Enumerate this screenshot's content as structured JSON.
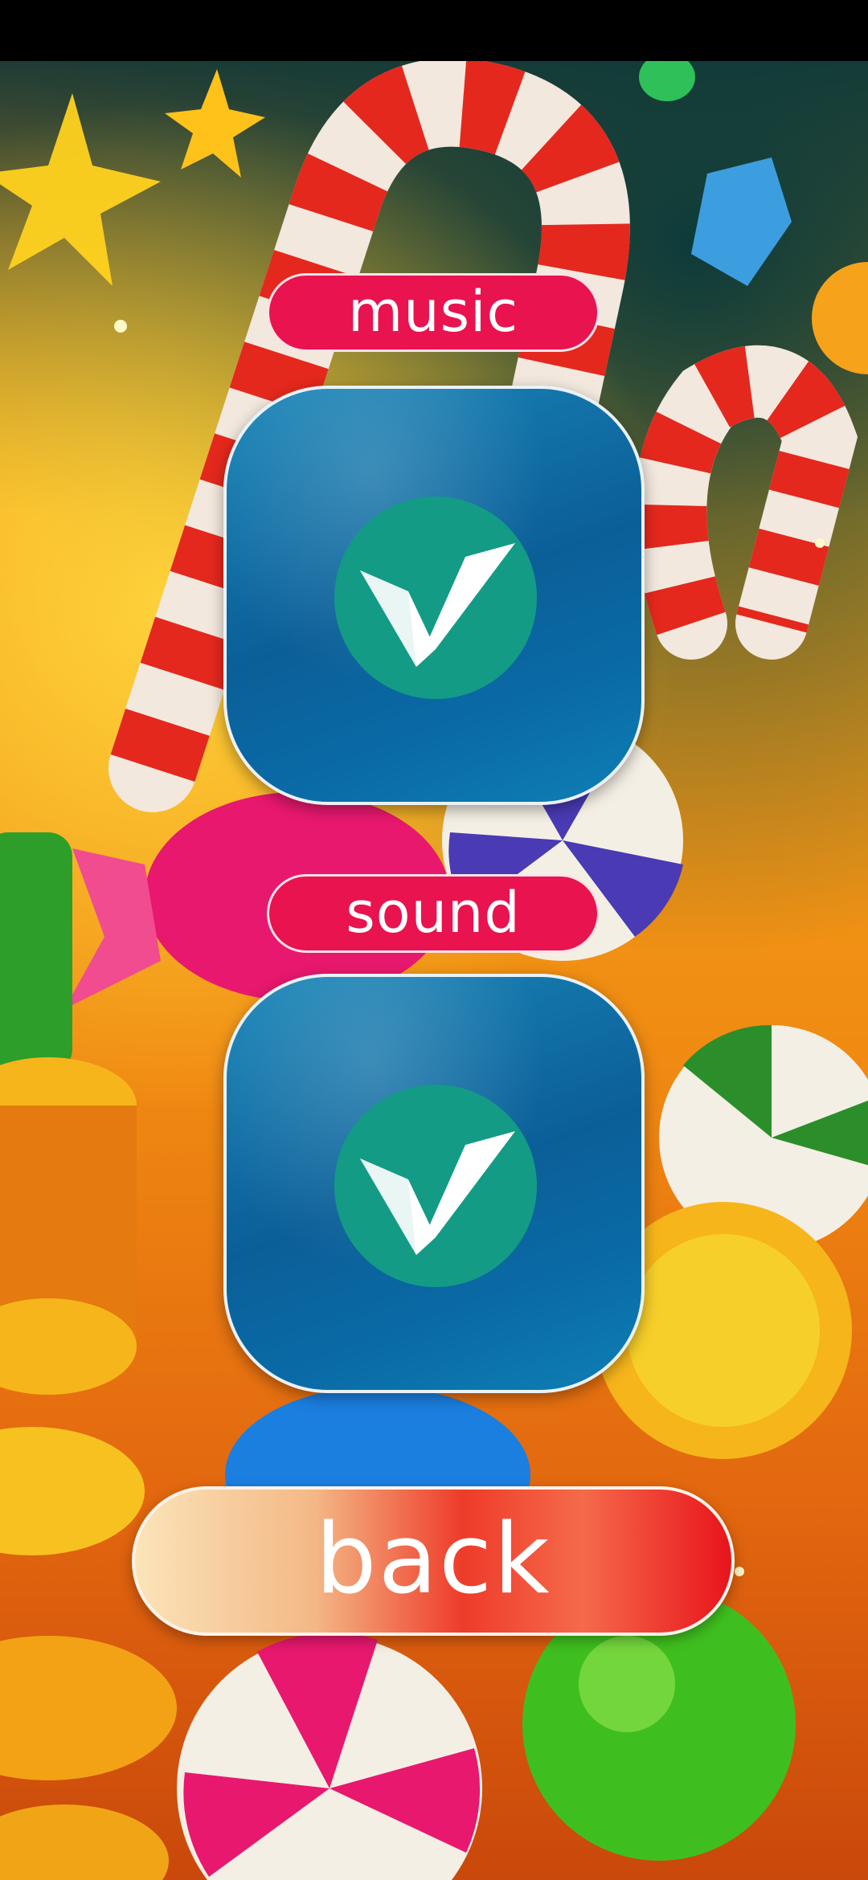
{
  "settings": {
    "music_label": "music",
    "sound_label": "sound",
    "music_enabled": true,
    "sound_enabled": true,
    "back_label": "back"
  },
  "colors": {
    "label_pill": "#e8134f",
    "toggle_bg": "#0b5f98",
    "check_circle": "#139b86",
    "back_button_left": "#fbe4b9",
    "back_button_right": "#e8141c"
  },
  "icons": {
    "toggle_icon": "checkmark-icon"
  }
}
